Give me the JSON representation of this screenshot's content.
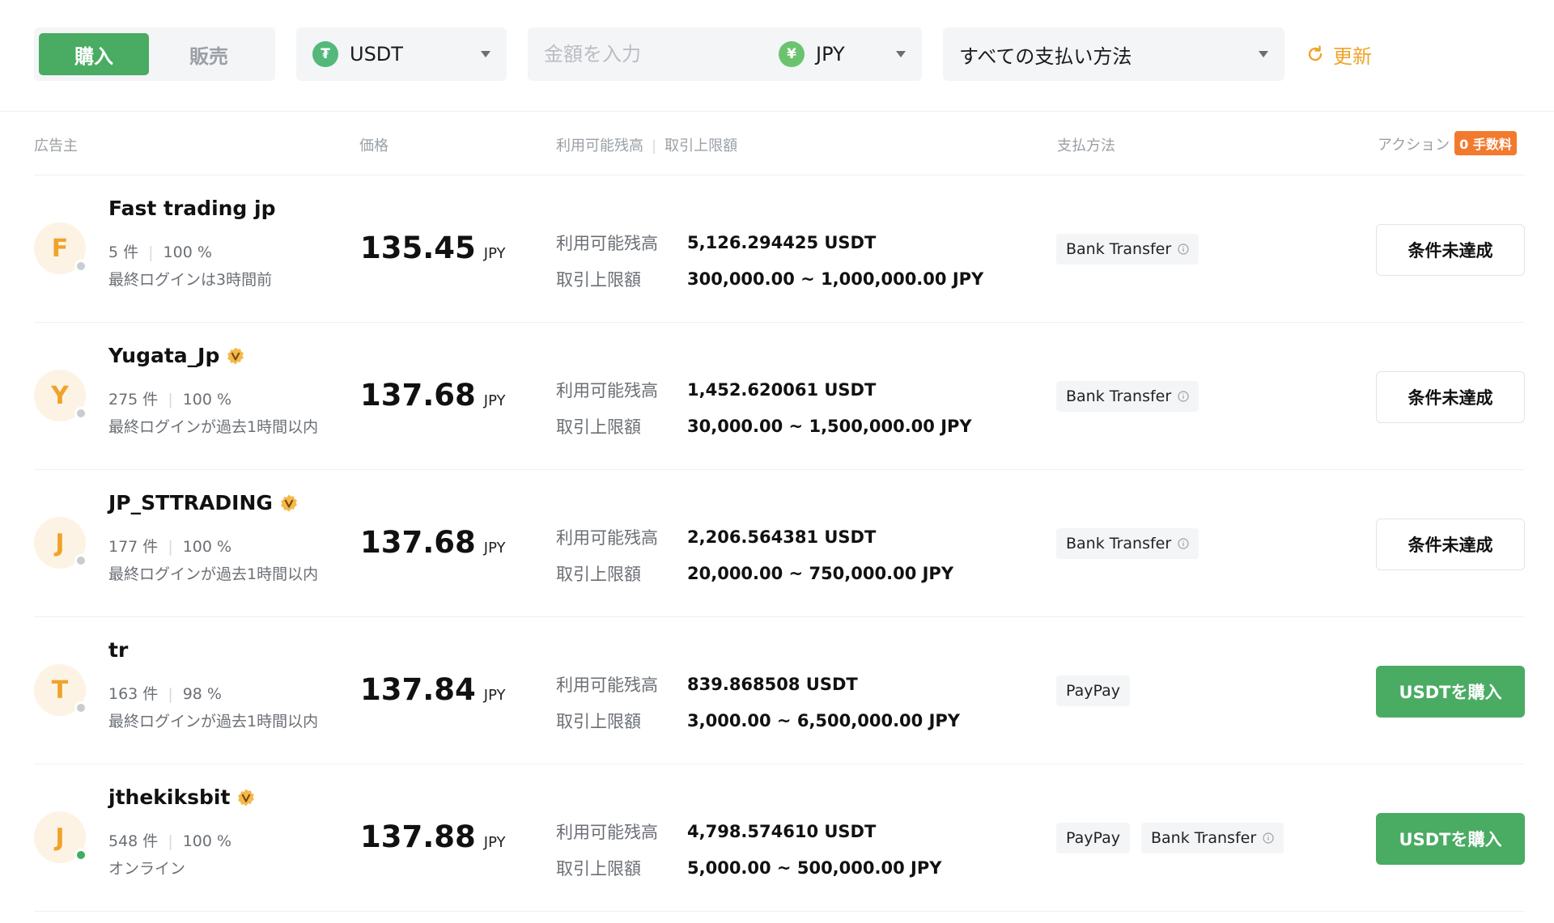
{
  "filter": {
    "buy_label": "購入",
    "sell_label": "販売",
    "coin": {
      "label": "USDT",
      "badge": "₮"
    },
    "amount": {
      "placeholder": "金額を入力",
      "currency": "JPY",
      "currency_badge": "¥"
    },
    "payment_method": "すべての支払い方法",
    "refresh_label": "更新"
  },
  "table_header": {
    "advertiser": "広告主",
    "price": "価格",
    "available": "利用可能残高",
    "limit": "取引上限額",
    "payment": "支払方法",
    "action": "アクション",
    "fee_badge": "0 手数料"
  },
  "labels": {
    "available": "利用可能残高",
    "limit": "取引上限額",
    "orders_unit": "件"
  },
  "rows": [
    {
      "initial": "F",
      "name": "Fast trading jp",
      "verified": false,
      "online": false,
      "orders": "5 件",
      "completion": "100 %",
      "login": "最終ログインは3時間前",
      "price": "135.45",
      "price_unit": "JPY",
      "available": "5,126.294425 USDT",
      "limit": "300,000.00 ~ 1,000,000.00 JPY",
      "payments": [
        {
          "label": "Bank Transfer",
          "info": true
        }
      ],
      "action": "条件未達成",
      "action_type": "unmet"
    },
    {
      "initial": "Y",
      "name": "Yugata_Jp",
      "verified": true,
      "online": false,
      "orders": "275 件",
      "completion": "100 %",
      "login": "最終ログインが過去1時間以内",
      "price": "137.68",
      "price_unit": "JPY",
      "available": "1,452.620061 USDT",
      "limit": "30,000.00 ~ 1,500,000.00 JPY",
      "payments": [
        {
          "label": "Bank Transfer",
          "info": true
        }
      ],
      "action": "条件未達成",
      "action_type": "unmet"
    },
    {
      "initial": "J",
      "name": "JP_STTRADING",
      "verified": true,
      "online": false,
      "orders": "177 件",
      "completion": "100 %",
      "login": "最終ログインが過去1時間以内",
      "price": "137.68",
      "price_unit": "JPY",
      "available": "2,206.564381 USDT",
      "limit": "20,000.00 ~ 750,000.00 JPY",
      "payments": [
        {
          "label": "Bank Transfer",
          "info": true
        }
      ],
      "action": "条件未達成",
      "action_type": "unmet"
    },
    {
      "initial": "T",
      "name": "tr",
      "verified": false,
      "online": false,
      "orders": "163 件",
      "completion": "98 %",
      "login": "最終ログインが過去1時間以内",
      "price": "137.84",
      "price_unit": "JPY",
      "available": "839.868508 USDT",
      "limit": "3,000.00 ~ 6,500,000.00 JPY",
      "payments": [
        {
          "label": "PayPay",
          "info": false
        }
      ],
      "action": "USDTを購入",
      "action_type": "buy"
    },
    {
      "initial": "J",
      "name": "jthekiksbit",
      "verified": true,
      "online": true,
      "orders": "548 件",
      "completion": "100 %",
      "login": "オンライン",
      "price": "137.88",
      "price_unit": "JPY",
      "available": "4,798.574610 USDT",
      "limit": "5,000.00 ~ 500,000.00 JPY",
      "payments": [
        {
          "label": "PayPay",
          "info": false
        },
        {
          "label": "Bank Transfer",
          "info": true
        }
      ],
      "action": "USDTを購入",
      "action_type": "buy"
    }
  ],
  "colors": {
    "accent_green": "#4aab63",
    "accent_orange": "#f0a32a",
    "fee_badge": "#f27a2e",
    "avatar_bg": "#fdf3e4",
    "online_dot": "#3fae5e",
    "offline_dot": "#c9ccd1"
  },
  "icons": {
    "coin": "usdt-coin-icon",
    "currency": "jpy-coin-icon",
    "refresh": "refresh-icon",
    "verified": "verified-badge-icon",
    "info": "info-icon",
    "dropdown": "caret-down-icon"
  }
}
